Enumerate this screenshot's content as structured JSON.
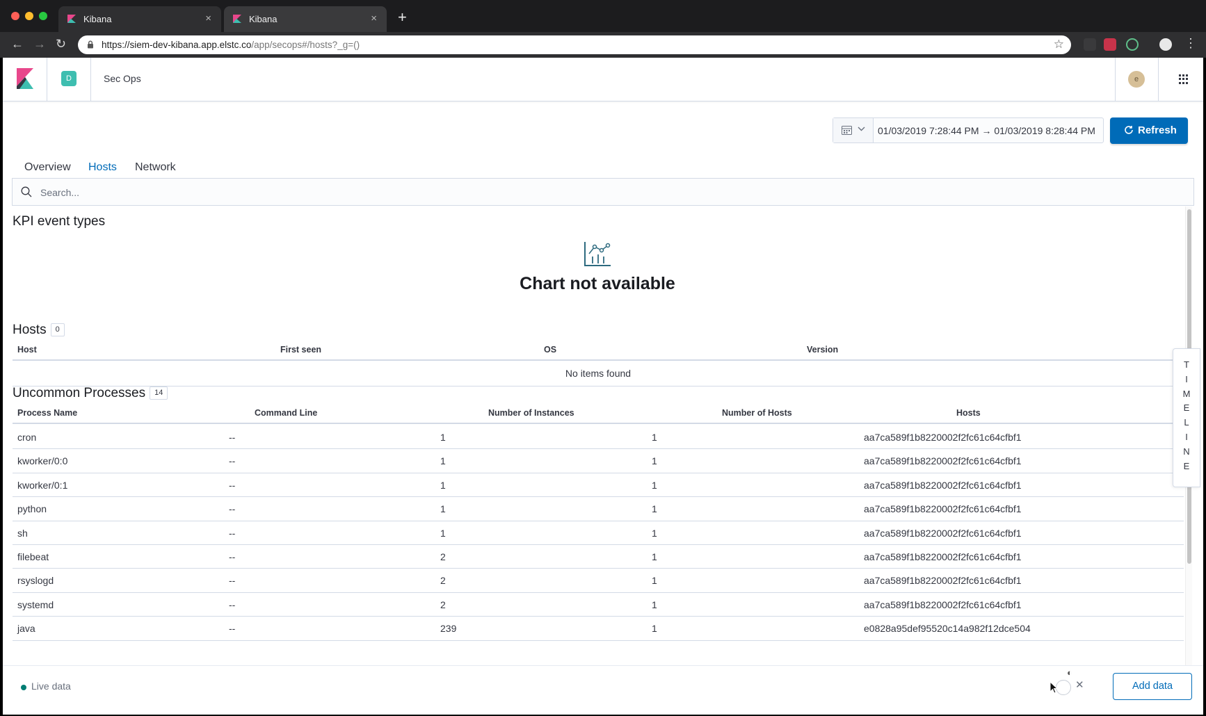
{
  "browser": {
    "tabs": [
      {
        "title": "Kibana",
        "close": "×"
      },
      {
        "title": "Kibana",
        "close": "×"
      }
    ],
    "new_tab": "+",
    "url_host": "https://siem-dev-kibana.app.elstc.co",
    "url_path": "/app/secops#/hosts?_g=()"
  },
  "header": {
    "space_initial": "D",
    "breadcrumb": "Sec Ops",
    "avatar_initial": "e"
  },
  "datepicker": {
    "range": "01/03/2019 7:28:44 PM → 01/03/2019 8:28:44 PM",
    "refresh_label": "Refresh"
  },
  "tabs": [
    "Overview",
    "Hosts",
    "Network"
  ],
  "search": {
    "placeholder": "Search..."
  },
  "kpi": {
    "title": "KPI event types",
    "empty_message": "Chart not available"
  },
  "hosts_table": {
    "title": "Hosts",
    "count": "0",
    "columns": [
      "Host",
      "First seen",
      "OS",
      "Version"
    ],
    "empty": "No items found"
  },
  "uncommon_processes": {
    "title": "Uncommon Processes",
    "count": "14",
    "columns": [
      "Process Name",
      "Command Line",
      "Number of Instances",
      "Number of Hosts",
      "Hosts"
    ],
    "rows": [
      {
        "name": "cron",
        "cmd": "--",
        "instances": "1",
        "hosts_count": "1",
        "hosts": "aa7ca589f1b8220002f2fc61c64cfbf1"
      },
      {
        "name": "kworker/0:0",
        "cmd": "--",
        "instances": "1",
        "hosts_count": "1",
        "hosts": "aa7ca589f1b8220002f2fc61c64cfbf1"
      },
      {
        "name": "kworker/0:1",
        "cmd": "--",
        "instances": "1",
        "hosts_count": "1",
        "hosts": "aa7ca589f1b8220002f2fc61c64cfbf1"
      },
      {
        "name": "python",
        "cmd": "--",
        "instances": "1",
        "hosts_count": "1",
        "hosts": "aa7ca589f1b8220002f2fc61c64cfbf1"
      },
      {
        "name": "sh",
        "cmd": "--",
        "instances": "1",
        "hosts_count": "1",
        "hosts": "aa7ca589f1b8220002f2fc61c64cfbf1"
      },
      {
        "name": "filebeat",
        "cmd": "--",
        "instances": "2",
        "hosts_count": "1",
        "hosts": "aa7ca589f1b8220002f2fc61c64cfbf1"
      },
      {
        "name": "rsyslogd",
        "cmd": "--",
        "instances": "2",
        "hosts_count": "1",
        "hosts": "aa7ca589f1b8220002f2fc61c64cfbf1"
      },
      {
        "name": "systemd",
        "cmd": "--",
        "instances": "2",
        "hosts_count": "1",
        "hosts": "aa7ca589f1b8220002f2fc61c64cfbf1"
      },
      {
        "name": "java",
        "cmd": "--",
        "instances": "239",
        "hosts_count": "1",
        "hosts": "e0828a95def95520c14a982f12dce504"
      }
    ]
  },
  "timeline": {
    "label": "TIMELINE"
  },
  "footer": {
    "live_label": "Live data",
    "add_data_label": "Add data"
  },
  "colors": {
    "accent": "#006bb8",
    "live": "#017d73",
    "space_badge": "#3ebeb0"
  }
}
